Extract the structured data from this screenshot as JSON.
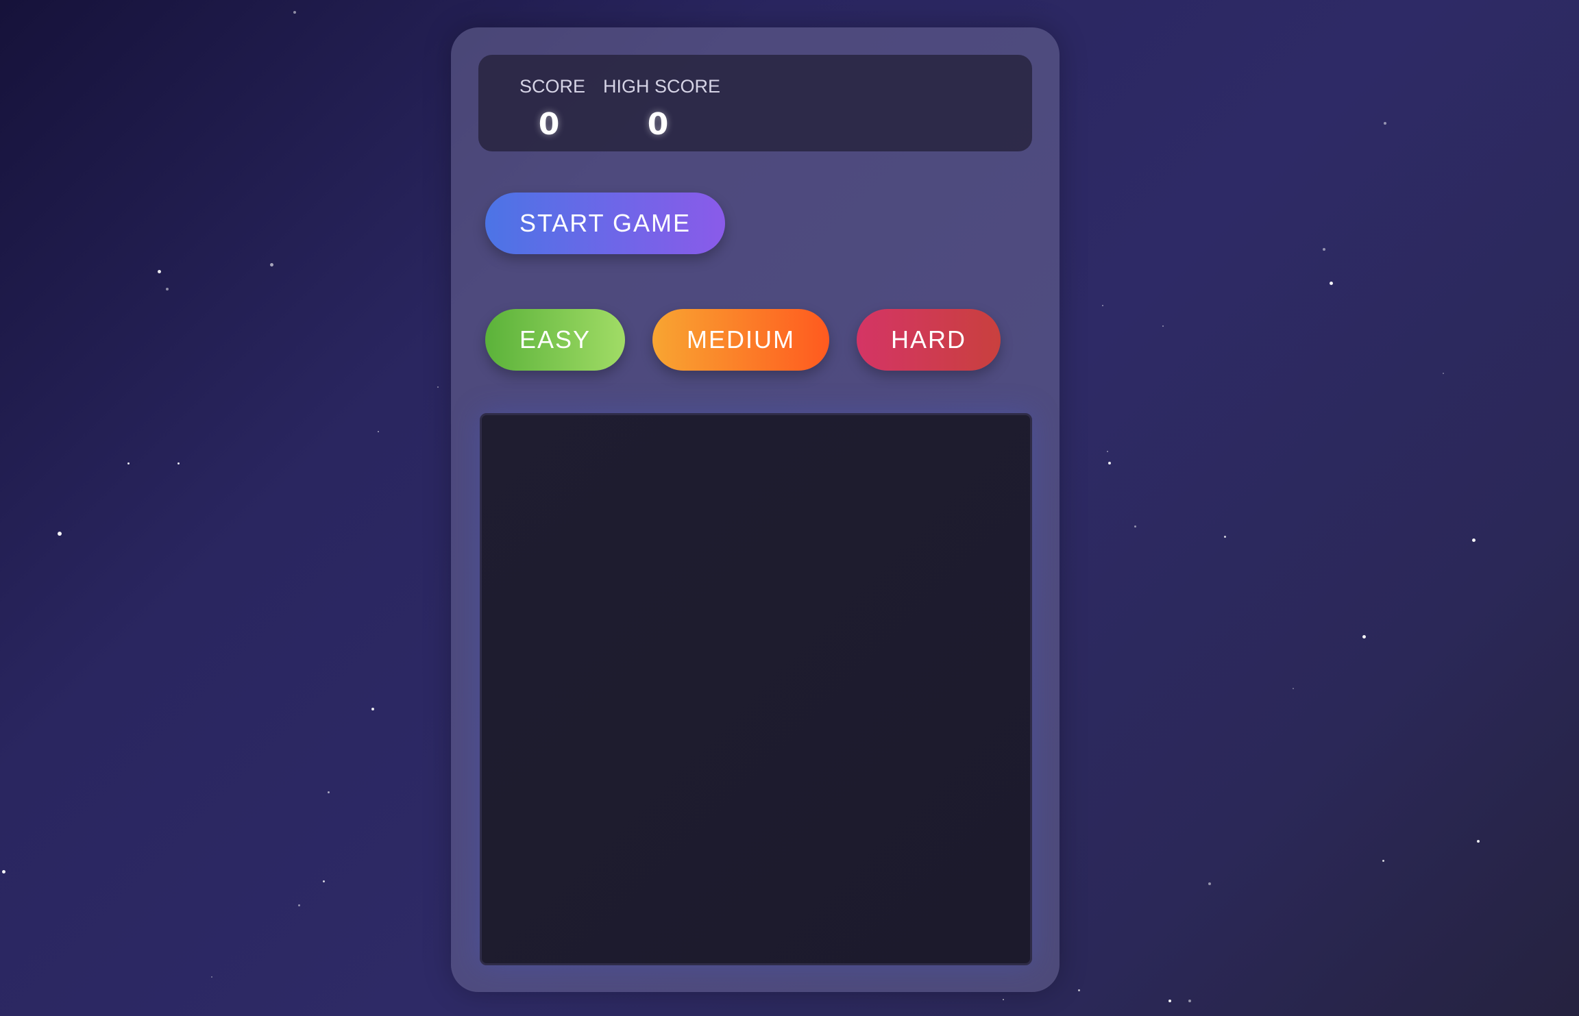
{
  "scoreboard": {
    "score_label": "SCORE",
    "score_value": "0",
    "high_score_label": "HIGH SCORE",
    "high_score_value": "0"
  },
  "controls": {
    "start_label": "START GAME",
    "difficulty": {
      "easy_label": "EASY",
      "medium_label": "MEDIUM",
      "hard_label": "HARD"
    }
  },
  "colors": {
    "start_gradient": [
      "#4c74e6",
      "#8a5be9"
    ],
    "easy_gradient": [
      "#5bb23a",
      "#a1dc66"
    ],
    "medium_gradient": [
      "#f8a532",
      "#ff5a1f"
    ],
    "hard_gradient": [
      "#d43565",
      "#c9403e"
    ],
    "board": "#1e1c2e",
    "background": "#2a2660"
  }
}
